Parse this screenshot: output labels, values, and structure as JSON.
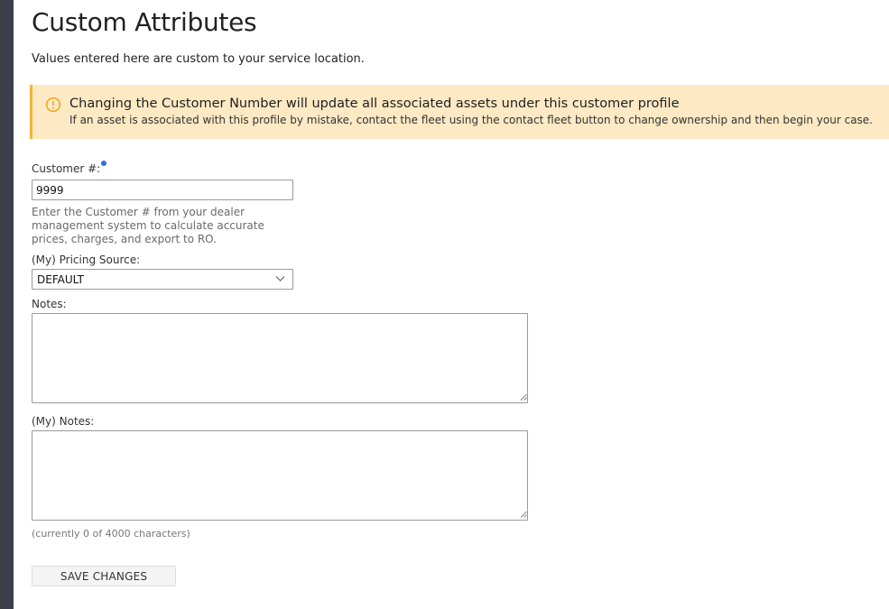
{
  "page": {
    "title": "Custom Attributes",
    "subtitle": "Values entered here are custom to your service location."
  },
  "alert": {
    "icon": "warning-circle-icon",
    "title": "Changing the Customer Number will update all associated assets under this customer profile",
    "body": "If an asset is associated with this profile by mistake, contact the fleet using the contact fleet button to change ownership and then begin your case.",
    "background_color": "#fde9c4",
    "accent_color": "#f0b336"
  },
  "form": {
    "customer_number": {
      "label": "Customer #:",
      "value": "9999",
      "required_indicator_color": "#2f6fde",
      "help": "Enter the Customer # from your dealer management system to calculate accurate prices, charges, and export to RO."
    },
    "pricing_source": {
      "label": "(My) Pricing Source:",
      "selected": "DEFAULT"
    },
    "notes": {
      "label": "Notes:",
      "value": ""
    },
    "my_notes": {
      "label": "(My) Notes:",
      "value": "",
      "char_count": "(currently 0 of 4000 characters)"
    },
    "save_label": "SAVE CHANGES"
  }
}
